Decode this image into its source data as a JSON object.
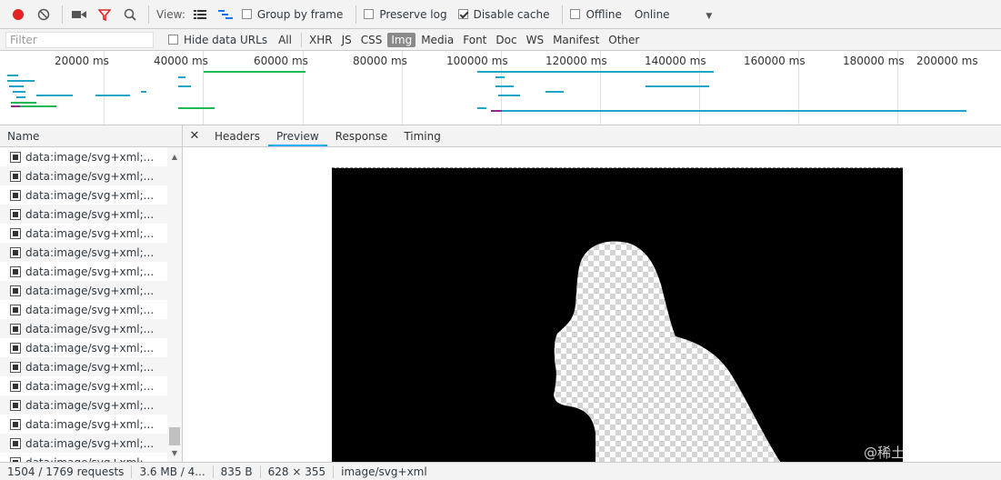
{
  "toolbar": {
    "view_label": "View:",
    "group_by_frame": "Group by frame",
    "preserve_log": "Preserve log",
    "disable_cache": "Disable cache",
    "offline": "Offline",
    "throttle": "Online",
    "disable_cache_checked": true
  },
  "filter": {
    "placeholder": "Filter",
    "hide_data_urls": "Hide data URLs",
    "types": [
      "All",
      "XHR",
      "JS",
      "CSS",
      "Img",
      "Media",
      "Font",
      "Doc",
      "WS",
      "Manifest",
      "Other"
    ],
    "active_type": "Img"
  },
  "overview": {
    "ticks": [
      "20000 ms",
      "40000 ms",
      "60000 ms",
      "80000 ms",
      "100000 ms",
      "120000 ms",
      "140000 ms",
      "160000 ms",
      "180000 ms",
      "200000 ms"
    ]
  },
  "names": {
    "header": "Name",
    "rows": [
      "data:image/svg+xml;...",
      "data:image/svg+xml;...",
      "data:image/svg+xml;...",
      "data:image/svg+xml;...",
      "data:image/svg+xml;...",
      "data:image/svg+xml;...",
      "data:image/svg+xml;...",
      "data:image/svg+xml;...",
      "data:image/svg+xml;...",
      "data:image/svg+xml;...",
      "data:image/svg+xml;...",
      "data:image/svg+xml;...",
      "data:image/svg+xml;...",
      "data:image/svg+xml;...",
      "data:image/svg+xml;...",
      "data:image/svg+xml;...",
      "data:image/svg+xml;..."
    ]
  },
  "detail": {
    "tabs": [
      "Headers",
      "Preview",
      "Response",
      "Timing"
    ],
    "active_tab": "Preview"
  },
  "status": {
    "requests": "1504 / 1769 requests",
    "transferred": "3.6 MB / 4...",
    "size": "835 B",
    "dimensions": "628 × 355",
    "mime": "image/svg+xml"
  },
  "watermark": "@稀土掘金技术社区",
  "colors": {
    "record": "#e52222",
    "filter_icon": "#e52222",
    "tab_accent": "#03a9f4",
    "bar_blue": "#1fa5c9",
    "bar_green": "#1db954"
  }
}
